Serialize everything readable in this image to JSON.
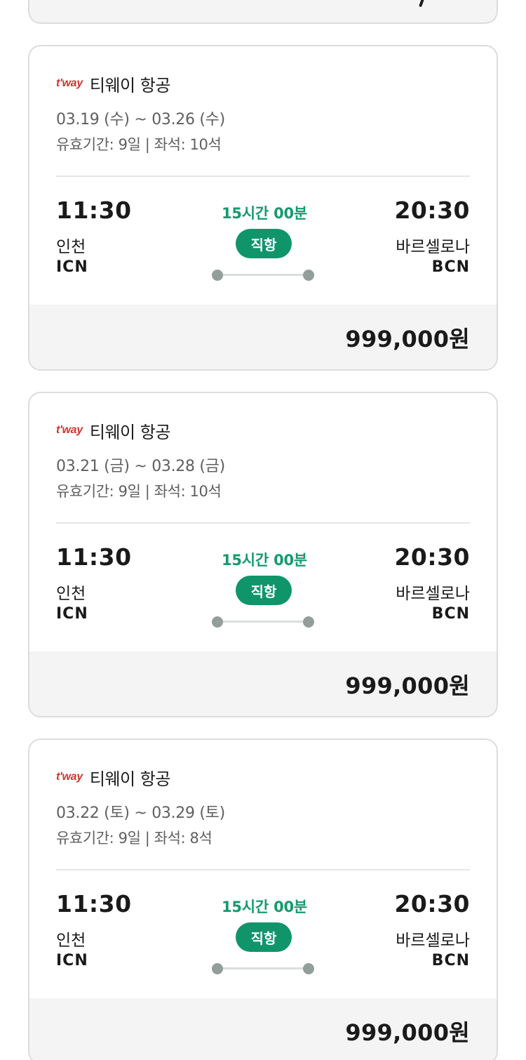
{
  "flights": [
    {
      "airline_logo": "t'way",
      "airline_name": "티웨이 항공",
      "dates": "03.19 (수) ~ 03.26 (수)",
      "meta": "유효기간: 9일 | 좌석: 10석",
      "departure": {
        "time": "11:30",
        "city": "인천",
        "code": "ICN"
      },
      "arrival": {
        "time": "20:30",
        "city": "바르셀로나",
        "code": "BCN"
      },
      "duration": "15시간 00분",
      "badge": "직항",
      "price": "999,000원"
    },
    {
      "airline_logo": "t'way",
      "airline_name": "티웨이 항공",
      "dates": "03.21 (금) ~ 03.28 (금)",
      "meta": "유효기간: 9일 | 좌석: 10석",
      "departure": {
        "time": "11:30",
        "city": "인천",
        "code": "ICN"
      },
      "arrival": {
        "time": "20:30",
        "city": "바르셀로나",
        "code": "BCN"
      },
      "duration": "15시간 00분",
      "badge": "직항",
      "price": "999,000원"
    },
    {
      "airline_logo": "t'way",
      "airline_name": "티웨이 항공",
      "dates": "03.22 (토) ~ 03.29 (토)",
      "meta": "유효기간: 9일 | 좌석: 8석",
      "departure": {
        "time": "11:30",
        "city": "인천",
        "code": "ICN"
      },
      "arrival": {
        "time": "20:30",
        "city": "바르셀로나",
        "code": "BCN"
      },
      "duration": "15시간 00분",
      "badge": "직항",
      "price": "999,000원"
    }
  ],
  "colors": {
    "accent_green": "#149a6e",
    "badge_green": "#10956a",
    "logo_red": "#d0342c",
    "price_bar": "#f4f4f4"
  }
}
